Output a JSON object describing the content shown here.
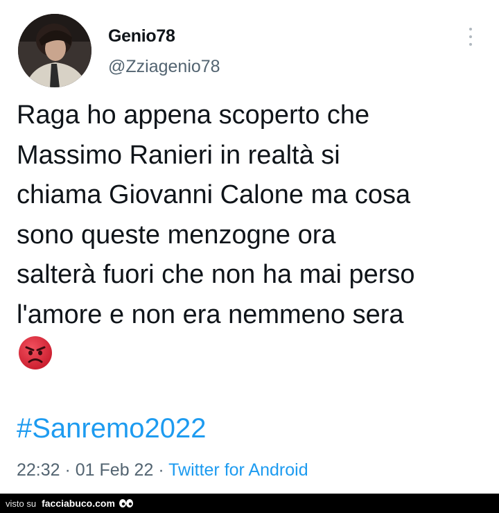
{
  "user": {
    "display_name": "Genio78",
    "handle": "@Zziagenio78"
  },
  "tweet": {
    "lines": [
      "Raga ho appena scoperto che",
      "Massimo Ranieri in realtà si",
      "chiama Giovanni Calone ma cosa",
      "sono queste menzogne ora",
      "salterà fuori che non ha mai perso",
      "l'amore e non era nemmeno sera"
    ],
    "emoji": "angry-face",
    "hashtag": "#Sanremo2022"
  },
  "meta": {
    "time": "22:32",
    "separator": " · ",
    "date": "01 Feb 22",
    "source": "Twitter for Android"
  },
  "footer": {
    "seen_on": "visto su",
    "site": "facciabuco.com",
    "logo_icon": "eyes-icon"
  },
  "colors": {
    "link": "#1d9bf0",
    "secondary_text": "#536471",
    "primary_text": "#0f1419",
    "emoji_red": "#e02637"
  }
}
